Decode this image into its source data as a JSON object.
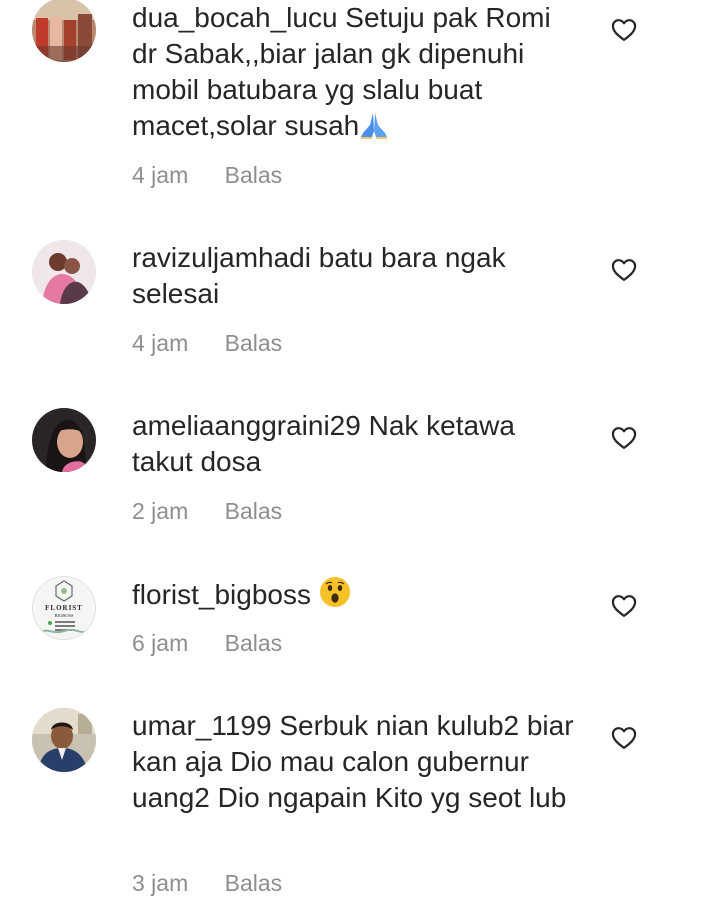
{
  "comments": [
    {
      "username": "dua_bocah_lucu",
      "text": "Setuju pak Romi dr Sabak,,biar jalan gk dipenuhi mobil batubara yg slalu buat macet,solar susah",
      "emoji": "folded-hands",
      "time": "4 jam",
      "reply": "Balas"
    },
    {
      "username": "ravizuljamhadi",
      "text": "batu bara ngak selesai",
      "time": "4 jam",
      "reply": "Balas"
    },
    {
      "username": "ameliaanggraini29",
      "text": "Nak ketawa takut dosa",
      "time": "2 jam",
      "reply": "Balas"
    },
    {
      "username": "florist_bigboss",
      "text": "",
      "emoji": "astonished-face",
      "avatar_text": "FLORIST BIGBOSS",
      "time": "6 jam",
      "reply": "Balas"
    },
    {
      "username": "umar_1199",
      "text": "Serbuk nian kulub2 biar kan aja Dio mau calon gubernur uang2 Dio ngapain Kito yg seot lub",
      "time": "3 jam",
      "reply": "Balas"
    }
  ],
  "colors": {
    "text": "#262626",
    "meta": "#8e8e8e",
    "emoji_yellow": "#f6c027",
    "pray_blue": "#4a8ee8"
  },
  "icons": {
    "like": "heart-outline-icon"
  }
}
